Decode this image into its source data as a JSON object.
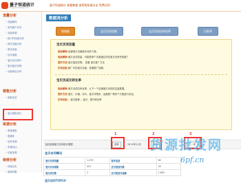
{
  "header": {
    "app_name": "量子恒道统计",
    "app_sub": "tongji.linezing.com",
    "notice": "量子恒道统计 查看数据 使用帮助请点击 免费试用"
  },
  "sidebar": {
    "groups": [
      {
        "title": "流量分析",
        "items": [
          "流量概况",
          "实时客户访问",
          "流量来源",
          "按小时流量分析",
          "按天流量分析",
          "受访页面",
          "访问深度",
          "宝贝访问排行",
          "宝贝被访详情",
          "访客地区分布"
        ]
      },
      {
        "title": "销售分析",
        "items": [
          "销售总览",
          "宝贝销售排行"
        ]
      },
      {
        "title": "来源分析",
        "items": [
          "淘宝搜索",
          "直通车",
          "站外来源",
          "来源对比",
          "访客来源"
        ]
      },
      {
        "title": "装修分析",
        "items": [
          "页面点击",
          "装修效果"
        ]
      }
    ]
  },
  "main": {
    "title": "数据流分析",
    "tabs": [
      "销售额",
      "宝贝页浏览数",
      "宝贝页成交转化率",
      "付款率"
    ],
    "sections": [
      {
        "title": "宝贝页浏览量",
        "lines": [
          {
            "k": "指标解释:",
            "v": "店铺宝贝页面被访问的人数。"
          },
          {
            "k": "指标解释:",
            "v": "宝贝页浏览量、可能是单个访客通过浏览宝贝页来完成推广"
          },
          {
            "k": "提升方法:",
            "v": "宝贝描述页等。 查看 宝贝推广方法"
          },
          {
            "k": "引导访客:",
            "v": "推广中的宝贝页面，查看推广效果。"
          }
        ]
      },
      {
        "title": "宝贝页成交转化率",
        "lines": [
          {
            "k": "指标解释:",
            "v": "宝贝页成交转化率，以下一个店铺宝贝页的成交量数据。"
          },
          {
            "k": "提升方法:",
            "v": "宝贝、价格、评价、宝贝详情页、运营推广等多个方面进行优化。"
          },
          {
            "k": "引导访客:",
            "v": "…宝贝推荐… 宝贝，提升转化率"
          }
        ]
      }
    ],
    "filter": {
      "label": "当前店铺宝贝访问统计数据",
      "btn_select": "选择",
      "date": "2011年11月",
      "btn_query": "查询",
      "btn_prev": "上一页",
      "badges": [
        "1",
        "2",
        "3"
      ]
    },
    "stats_title": "宝贝访问情况",
    "stats_rows": [
      [
        "宝贝页浏览量",
        "1,279",
        "客件信息",
        "62"
      ],
      [
        "宝贝页访客数",
        "421",
        "支付宝成交数",
        "45"
      ],
      [
        "宝贝成交数",
        "2",
        "支付宝成交金额",
        "1,650"
      ]
    ],
    "bottom_title": "宝贝访问TOP10"
  },
  "watermark": {
    "text": "货源批发网",
    "url": "6pf.cn"
  },
  "colors": {
    "accent": "#e08a2a",
    "highlight": "#e33333",
    "link": "#2e6ea6",
    "tab_inactive": "#7e9fc4"
  }
}
